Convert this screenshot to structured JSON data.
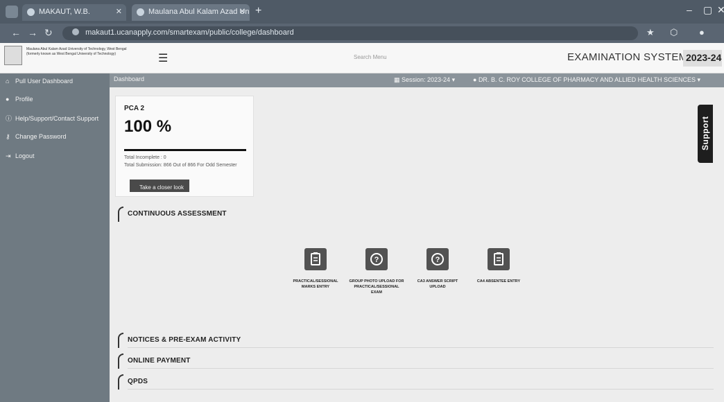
{
  "browser": {
    "tabs": [
      {
        "label": "MAKAUT, W.B."
      },
      {
        "label": "Maulana Abul Kalam Azad Univ..."
      }
    ],
    "url": "makaut1.ucanapply.com/smartexam/public/college/dashboard"
  },
  "header": {
    "university_lines": [
      "Maulana Abul Kalam Azad University of Technology, West Bengal",
      "(formerly known as West Bengal University of Technology)"
    ],
    "search_menu": "Search Menu",
    "exam_system": "EXAMINATION SYSTEM",
    "year": "2023-24"
  },
  "sidebar": {
    "items": [
      {
        "label": "Pull User Dashboard",
        "icon": "home-icon"
      },
      {
        "label": "Profile",
        "icon": "user-icon"
      },
      {
        "label": "Help/Support/Contact Support",
        "icon": "info-icon"
      },
      {
        "label": "Change Password",
        "icon": "key-icon"
      },
      {
        "label": "Logout",
        "icon": "logout-icon"
      }
    ]
  },
  "topbar": {
    "breadcrumb": "Dashboard",
    "session": "Session: 2023-24",
    "college": "DR. B. C. ROY COLLEGE OF PHARMACY AND ALLIED HEALTH SCIENCES"
  },
  "card": {
    "title": "PCA 2",
    "percent": "100 %",
    "percent_value": 1.0,
    "line1": "Total Incomplete : 0",
    "line2": "Total Submission: 866 Out of 866 For Odd Semester",
    "button": "Take a closer look"
  },
  "sections": [
    {
      "label": "CONTINUOUS ASSESSMENT"
    },
    {
      "label": "NOTICES & PRE-EXAM ACTIVITY"
    },
    {
      "label": "ONLINE PAYMENT"
    },
    {
      "label": "QPDS"
    }
  ],
  "tiles": [
    {
      "label": "PRACTICAL/SESSIONAL MARKS ENTRY",
      "icon": "clipboard-icon"
    },
    {
      "label": "GROUP PHOTO UPLOAD FOR PRACTICAL/SESSIONAL EXAM",
      "icon": "question-icon"
    },
    {
      "label": "CA3 ANSWER SCRIPT UPLOAD",
      "icon": "question-icon"
    },
    {
      "label": "CA4 ABSENTEE ENTRY",
      "icon": "clipboard-icon"
    }
  ],
  "support": {
    "label": "Support"
  }
}
